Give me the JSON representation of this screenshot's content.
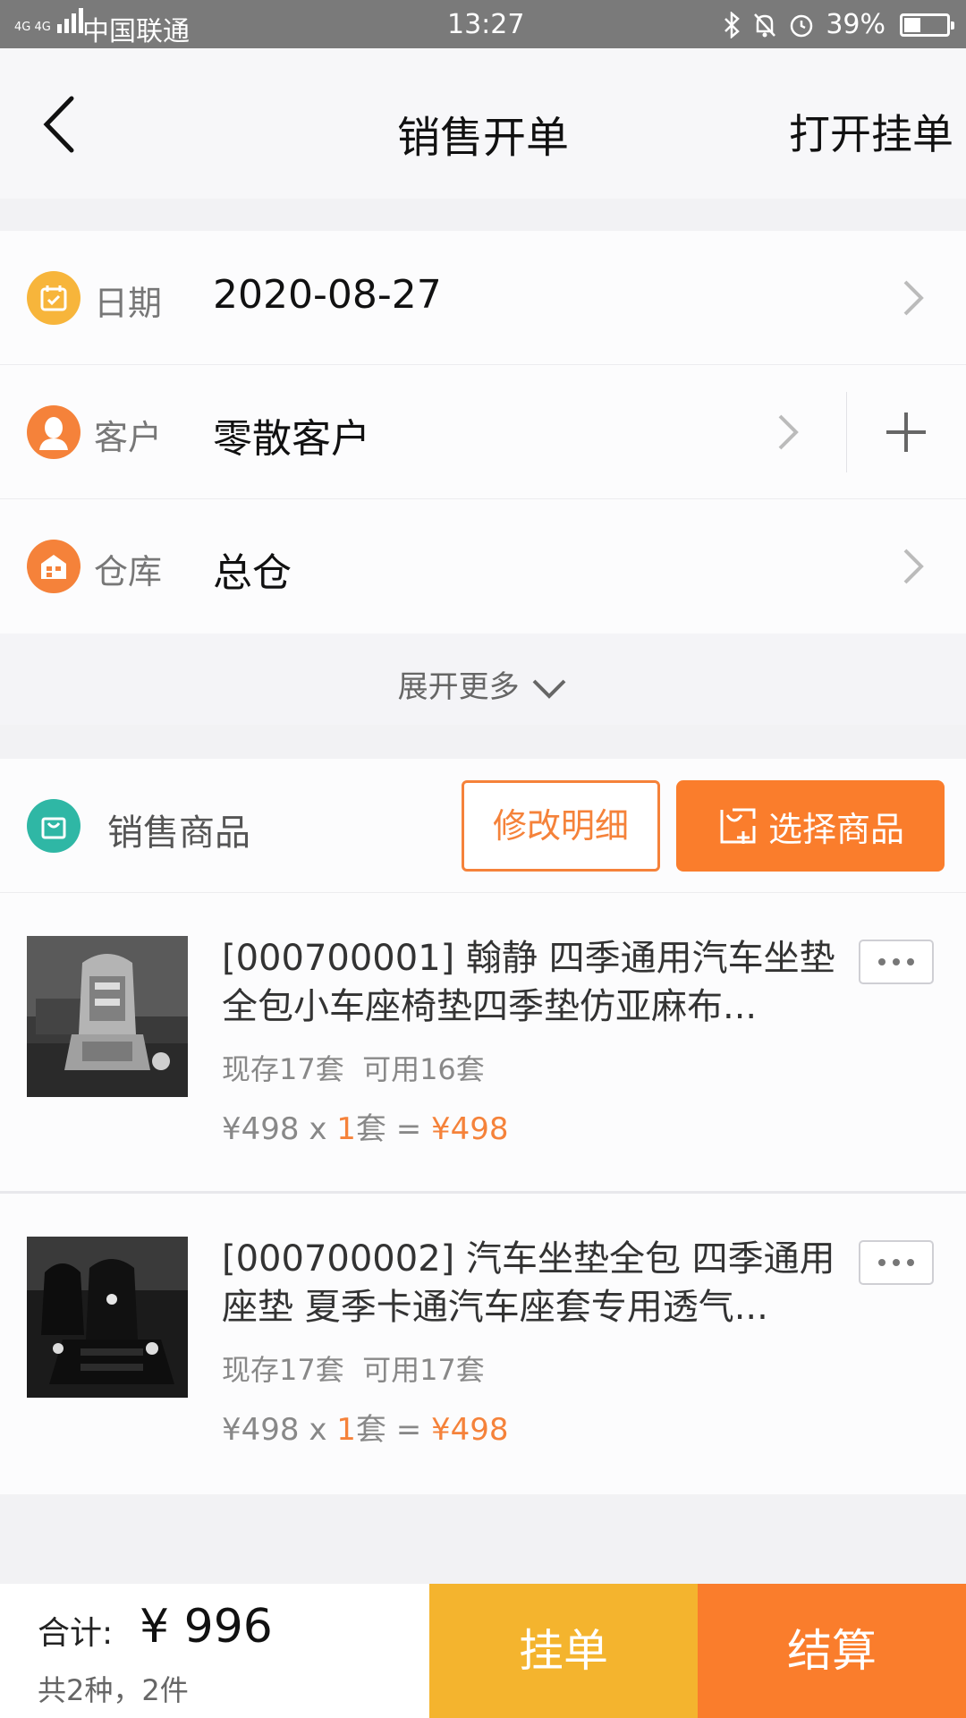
{
  "status_bar": {
    "network": "4G 4G",
    "carrier": "中国联通",
    "time": "13:27",
    "battery": "39%",
    "battery_level": 0.39,
    "icons": [
      "bluetooth-icon",
      "bell-muted-icon",
      "alarm-icon",
      "battery-icon"
    ]
  },
  "header": {
    "title": "销售开单",
    "open_pending": "打开挂单"
  },
  "form": {
    "date": {
      "label": "日期",
      "value": "2020-08-27",
      "icon": "calendar-icon",
      "icon_color": "#f7b53b"
    },
    "customer": {
      "label": "客户",
      "value": "零散客户",
      "icon": "person-icon",
      "icon_color": "#f5823a"
    },
    "warehouse": {
      "label": "仓库",
      "value": "总仓",
      "icon": "warehouse-icon",
      "icon_color": "#f5823a"
    },
    "expand_more": "展开更多"
  },
  "goods": {
    "section_label": "销售商品",
    "edit_detail": "修改明细",
    "select_goods": "选择商品",
    "items": [
      {
        "name": "[000700001] 翰静 四季通用汽车坐垫全包小车座椅垫四季垫仿亚麻布...",
        "stock": "现存17套  可用16套",
        "unit_price": "¥498 x ",
        "qty": "1",
        "unit": "套 = ",
        "subtotal": "¥498",
        "image": "gray-car-seat-cover"
      },
      {
        "name": "[000700002] 汽车坐垫全包 四季通用座垫 夏季卡通汽车座套专用透气...",
        "stock": "现存17套  可用17套",
        "unit_price": "¥498 x ",
        "qty": "1",
        "unit": "套 = ",
        "subtotal": "¥498",
        "image": "black-car-seat-cover"
      }
    ]
  },
  "footer": {
    "total_label": "合计:",
    "total_value": "¥ 996",
    "count": "共2种，2件",
    "hang_order": "挂单",
    "settle": "结算"
  },
  "colors": {
    "accent_orange": "#fa7d2c",
    "accent_yellow": "#f4b42e",
    "teal": "#2fb7a5"
  }
}
